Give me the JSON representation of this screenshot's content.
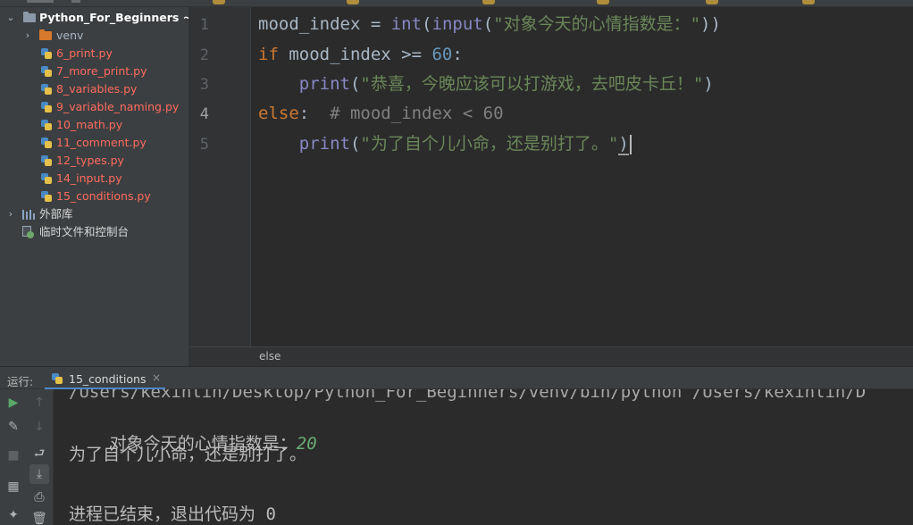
{
  "project_tree": {
    "root": {
      "label": "Python_For_Beginners ~"
    },
    "venv": {
      "label": "venv"
    },
    "files": [
      {
        "label": "6_print.py"
      },
      {
        "label": "7_more_print.py"
      },
      {
        "label": "8_variables.py"
      },
      {
        "label": "9_variable_naming.py"
      },
      {
        "label": "10_math.py"
      },
      {
        "label": "11_comment.py"
      },
      {
        "label": "12_types.py"
      },
      {
        "label": "14_input.py"
      },
      {
        "label": "15_conditions.py"
      }
    ],
    "external_libs": {
      "label": "外部库"
    },
    "scratches": {
      "label": "临时文件和控制台"
    }
  },
  "editor": {
    "line_numbers": [
      "1",
      "2",
      "3",
      "4",
      "5"
    ],
    "active_line": "4",
    "lines": [
      [
        {
          "t": "mood_index = ",
          "c": ""
        },
        {
          "t": "int",
          "c": "bi"
        },
        {
          "t": "(",
          "c": ""
        },
        {
          "t": "input",
          "c": "bi"
        },
        {
          "t": "(",
          "c": ""
        },
        {
          "t": "\"对象今天的心情指数是：\"",
          "c": "st"
        },
        {
          "t": "))",
          "c": ""
        }
      ],
      [
        {
          "t": "if",
          "c": "kw"
        },
        {
          "t": " mood_index >= ",
          "c": ""
        },
        {
          "t": "60",
          "c": "nm"
        },
        {
          "t": ":",
          "c": ""
        }
      ],
      [
        {
          "t": "    ",
          "c": ""
        },
        {
          "t": "print",
          "c": "bi"
        },
        {
          "t": "(",
          "c": ""
        },
        {
          "t": "\"恭喜，今晚应该可以打游戏，去吧皮卡丘！\"",
          "c": "st"
        },
        {
          "t": ")",
          "c": ""
        }
      ],
      [
        {
          "t": "else",
          "c": "kw"
        },
        {
          "t": ":  ",
          "c": ""
        },
        {
          "t": "# mood_index < 60",
          "c": "cm"
        }
      ],
      [
        {
          "t": "    ",
          "c": ""
        },
        {
          "t": "print",
          "c": "bi"
        },
        {
          "t": "(",
          "c": ""
        },
        {
          "t": "\"为了自个儿小命，还是别打了。\"",
          "c": "st"
        },
        {
          "t": ")",
          "c": "bracket"
        }
      ]
    ]
  },
  "breadcrumb": {
    "text": "else"
  },
  "run_panel": {
    "label": "运行:",
    "tab_label": "15_conditions",
    "tab_close": "×",
    "console": {
      "path_line": "/Users/kexinlin/Desktop/Python_For_Beginners/venv/bin/python /Users/kexinlin/D",
      "prompt": "对象今天的心情指数是：",
      "user_input": "20",
      "output": "为了自个儿小命，还是别打了。",
      "exit": "进程已结束，退出代码为 0"
    }
  },
  "colors": {
    "keyword": "#cc7832",
    "builtin": "#8888c6",
    "string": "#6a8759",
    "number": "#6897bb",
    "comment": "#808080",
    "file_red": "#ff6b5f",
    "selection": "#0d293e",
    "run_tab_underline": "#4a88c7"
  },
  "icons": {
    "run": "play-icon",
    "rerun_up": "arrow-up-icon",
    "build": "wrench-icon",
    "down": "arrow-down-icon",
    "stop": "stop-icon",
    "soft_wrap": "soft-wrap-icon",
    "scroll_end": "scroll-to-end-icon",
    "layout": "layout-icon",
    "print": "print-icon",
    "pin": "pin-icon",
    "trash": "trash-icon"
  }
}
